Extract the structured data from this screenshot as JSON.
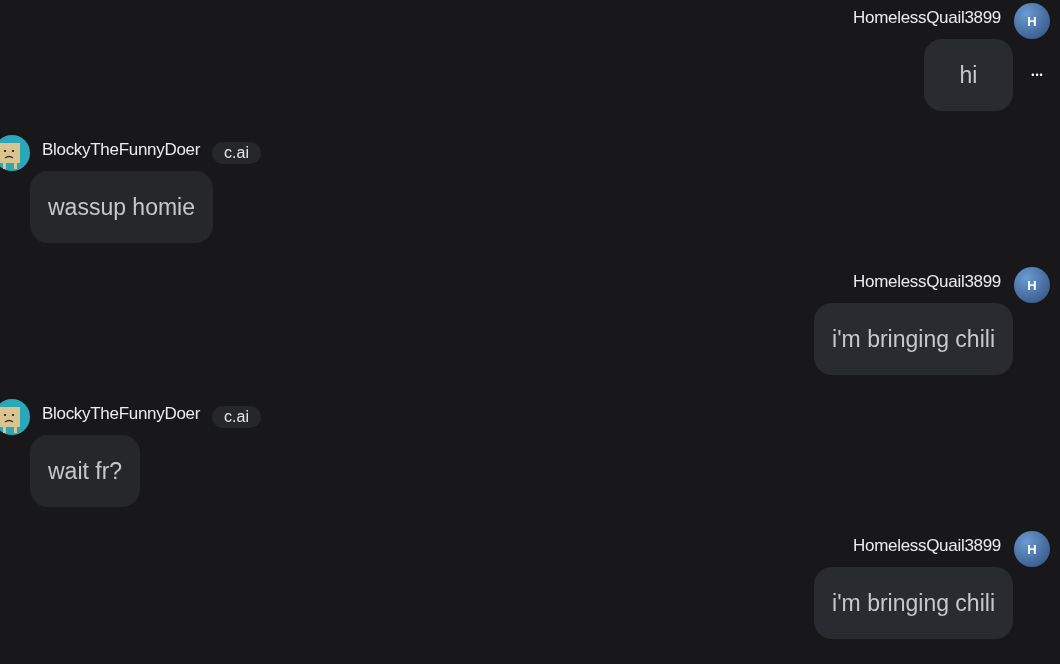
{
  "messages": [
    {
      "kind": "user",
      "name": "HomelessQuail3899",
      "avatar_letter": "H",
      "text": "hi",
      "menu": "•••"
    },
    {
      "kind": "bot",
      "name": "BlockyTheFunnyDoer",
      "tag": "c.ai",
      "text": "wassup homie"
    },
    {
      "kind": "user",
      "name": "HomelessQuail3899",
      "avatar_letter": "H",
      "text": "i'm bringing chili"
    },
    {
      "kind": "bot",
      "name": "BlockyTheFunnyDoer",
      "tag": "c.ai",
      "text": "wait fr?"
    },
    {
      "kind": "user",
      "name": "HomelessQuail3899",
      "avatar_letter": "H",
      "text": "i'm bringing chili"
    }
  ]
}
